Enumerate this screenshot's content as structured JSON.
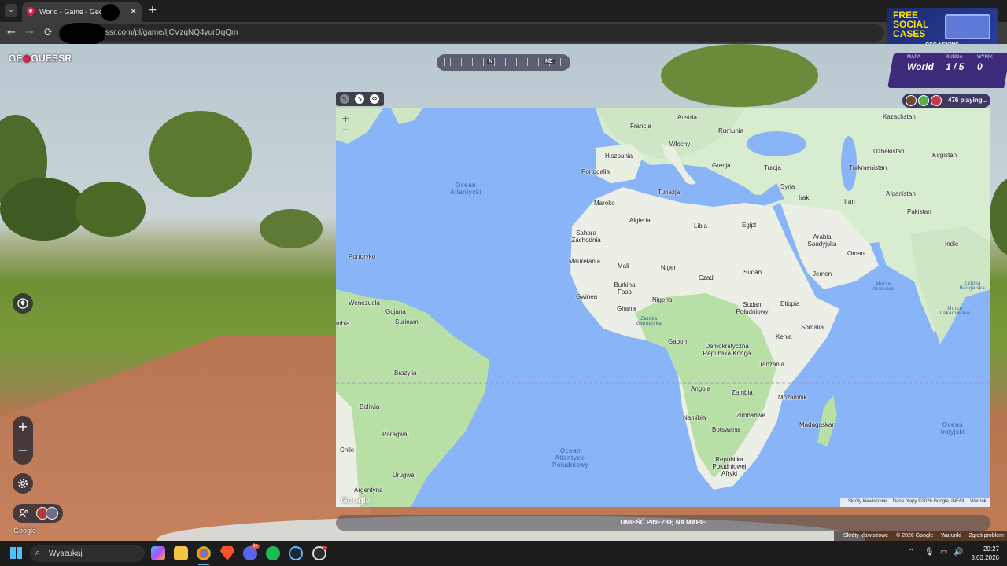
{
  "browser": {
    "tab_title": "World - Game - GeoGu",
    "tab_close": "✕",
    "tab_list": "⌄",
    "new_tab": "+",
    "url": "ssr.com/pl/game/IjCVzqNQ4yurDqQm",
    "back": "←",
    "forward": "→",
    "reload": "⟳"
  },
  "ad": {
    "line1": "FREE",
    "line2": "SOCIAL",
    "line3": "CASES",
    "brand": "CSG★SKINS"
  },
  "game": {
    "logo_pre": "GE",
    "logo_pin": "◉",
    "logo_post": "GUESSR",
    "compass": {
      "n": "N",
      "ne": "NE"
    },
    "score": {
      "map_label": "MAPA",
      "map_value": "World",
      "round_label": "RUNDA",
      "round_value": "1 / 5",
      "score_label": "WYNIK",
      "score_value": "0"
    },
    "players_text": "476 playing...",
    "zoom_in": "+",
    "zoom_out": "−",
    "google": "Google",
    "place_pin": "UMIEŚĆ PINEZKĘ NA MAPIE",
    "attribution": [
      "Skróty klawiszowe",
      "© 2026 Google",
      "Warunki",
      "Zgłoś problem"
    ]
  },
  "map": {
    "zoom_in": "+",
    "zoom_out": "−",
    "google": "Google",
    "attribution": [
      "Skróty klawiszowe",
      "Dane mapy ©2026 Google, INEGI",
      "Warunki"
    ],
    "countries": [
      {
        "name": "Kazachstan"
      },
      {
        "name": "Austria"
      },
      {
        "name": "Francja"
      },
      {
        "name": "Rumunia"
      },
      {
        "name": "Uzbekistan"
      },
      {
        "name": "Kirgistan"
      },
      {
        "name": "Hiszpania"
      },
      {
        "name": "Włochy"
      },
      {
        "name": "Turkmenistan"
      },
      {
        "name": "Portugalia"
      },
      {
        "name": "Grecja"
      },
      {
        "name": "Turcja"
      },
      {
        "name": "Tunezja"
      },
      {
        "name": "Syria"
      },
      {
        "name": "Afganistan"
      },
      {
        "name": "Maroko"
      },
      {
        "name": "Irak"
      },
      {
        "name": "Iran"
      },
      {
        "name": "Algieria"
      },
      {
        "name": "Pakistan"
      },
      {
        "name": "Libia"
      },
      {
        "name": "Egipt"
      },
      {
        "name": "Sahara Zachodnia"
      },
      {
        "name": "Arabia Saudyjska"
      },
      {
        "name": "Indie"
      },
      {
        "name": "Portoryko"
      },
      {
        "name": "Mauretania"
      },
      {
        "name": "Oman"
      },
      {
        "name": "Mali"
      },
      {
        "name": "Niger"
      },
      {
        "name": "Sudan"
      },
      {
        "name": "Czad"
      },
      {
        "name": "Jemen"
      },
      {
        "name": "Burkina Faso"
      },
      {
        "name": "Gwinea"
      },
      {
        "name": "Nigeria"
      },
      {
        "name": "Wenezuela"
      },
      {
        "name": "Sudan Południowy"
      },
      {
        "name": "Etiopia"
      },
      {
        "name": "Gujana"
      },
      {
        "name": "Ghana"
      },
      {
        "name": "Surinam"
      },
      {
        "name": "Somalia"
      },
      {
        "name": "Kenia"
      },
      {
        "name": "Gabon"
      },
      {
        "name": "Demokratyczna Republika Konga"
      },
      {
        "name": "Tanzania"
      },
      {
        "name": "Brazylia"
      },
      {
        "name": "Angola"
      },
      {
        "name": "Zambia"
      },
      {
        "name": "Mozambik"
      },
      {
        "name": "Boliwia"
      },
      {
        "name": "Namibia"
      },
      {
        "name": "Zimbabwe"
      },
      {
        "name": "Madagaskar"
      },
      {
        "name": "Paragwaj"
      },
      {
        "name": "Botswana"
      },
      {
        "name": "Chile"
      },
      {
        "name": "Republika Południowej Afryki"
      },
      {
        "name": "Urugwaj"
      },
      {
        "name": "Argentyna"
      },
      {
        "name": "mbia"
      }
    ],
    "oceans": [
      {
        "name": "Ocean Atlantycki"
      },
      {
        "name": "Ocean Atlantycki Południowy"
      },
      {
        "name": "Ocean Indyjski"
      },
      {
        "name": "Morze Arabskie"
      },
      {
        "name": "Zatoka Gwinejska"
      },
      {
        "name": "Zatoka Bengalska"
      },
      {
        "name": "Morze Lakadiwskie"
      }
    ]
  },
  "taskbar": {
    "search_placeholder": "Wyszukaj",
    "time": "20:27",
    "date": "3.03.2026",
    "discord_badge": "9+"
  }
}
